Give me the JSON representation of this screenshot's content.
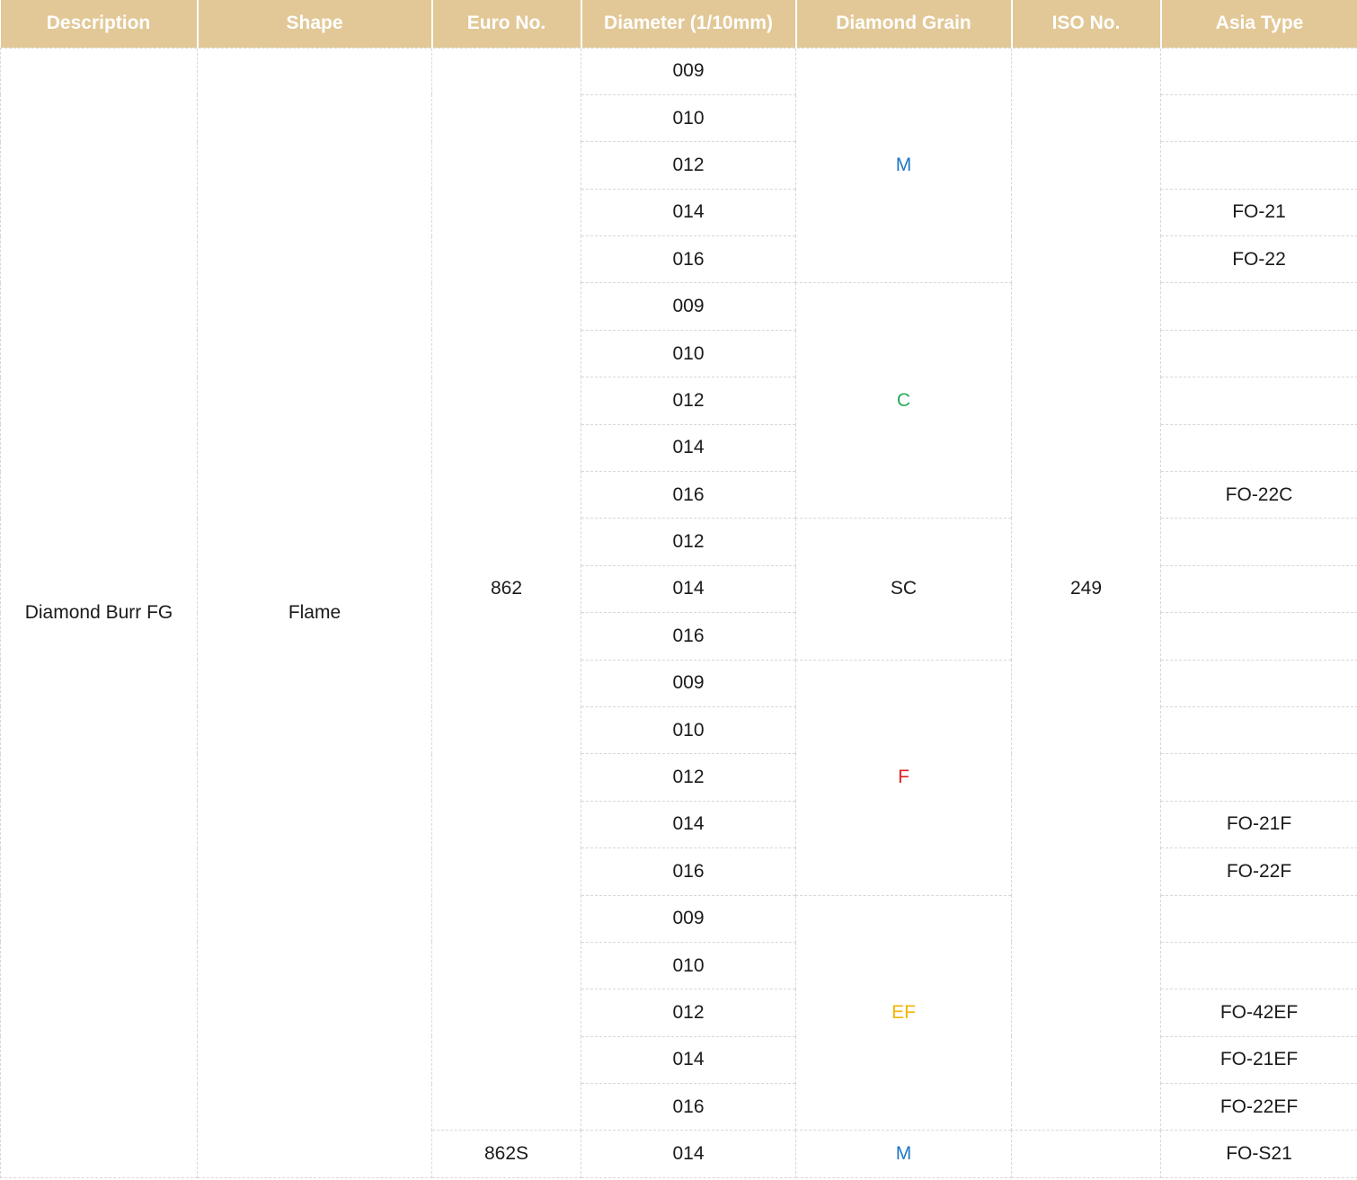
{
  "colors": {
    "header_bg": "#e2c897",
    "header_text": "#ffffff",
    "grain_M": "#1f77c4",
    "grain_C": "#2aab5a",
    "grain_SC": "#1a1a1a",
    "grain_F": "#e02020",
    "grain_EF": "#f5b400"
  },
  "table": {
    "headers": [
      "Description",
      "Shape",
      "Euro No.",
      "Diameter (1/10mm)",
      "Diamond Grain",
      "ISO No.",
      "Asia Type"
    ],
    "description": "Diamond Burr FG",
    "shape": "Flame",
    "euro_groups": [
      {
        "euro": "862",
        "iso": "249"
      },
      {
        "euro": "862S",
        "iso": ""
      }
    ],
    "grain_groups": [
      {
        "grain": "M"
      },
      {
        "grain": "C"
      },
      {
        "grain": "SC"
      },
      {
        "grain": "F"
      },
      {
        "grain": "EF"
      },
      {
        "grain": "M"
      }
    ],
    "rows": [
      {
        "diameter": "009",
        "asia": ""
      },
      {
        "diameter": "010",
        "asia": ""
      },
      {
        "diameter": "012",
        "asia": ""
      },
      {
        "diameter": "014",
        "asia": "FO-21"
      },
      {
        "diameter": "016",
        "asia": "FO-22"
      },
      {
        "diameter": "009",
        "asia": ""
      },
      {
        "diameter": "010",
        "asia": ""
      },
      {
        "diameter": "012",
        "asia": ""
      },
      {
        "diameter": "014",
        "asia": ""
      },
      {
        "diameter": "016",
        "asia": "FO-22C"
      },
      {
        "diameter": "012",
        "asia": ""
      },
      {
        "diameter": "014",
        "asia": ""
      },
      {
        "diameter": "016",
        "asia": ""
      },
      {
        "diameter": "009",
        "asia": ""
      },
      {
        "diameter": "010",
        "asia": ""
      },
      {
        "diameter": "012",
        "asia": ""
      },
      {
        "diameter": "014",
        "asia": "FO-21F"
      },
      {
        "diameter": "016",
        "asia": "FO-22F"
      },
      {
        "diameter": "009",
        "asia": ""
      },
      {
        "diameter": "010",
        "asia": ""
      },
      {
        "diameter": "012",
        "asia": "FO-42EF"
      },
      {
        "diameter": "014",
        "asia": "FO-21EF"
      },
      {
        "diameter": "016",
        "asia": "FO-22EF"
      },
      {
        "diameter": "014",
        "asia": "FO-S21"
      }
    ]
  }
}
